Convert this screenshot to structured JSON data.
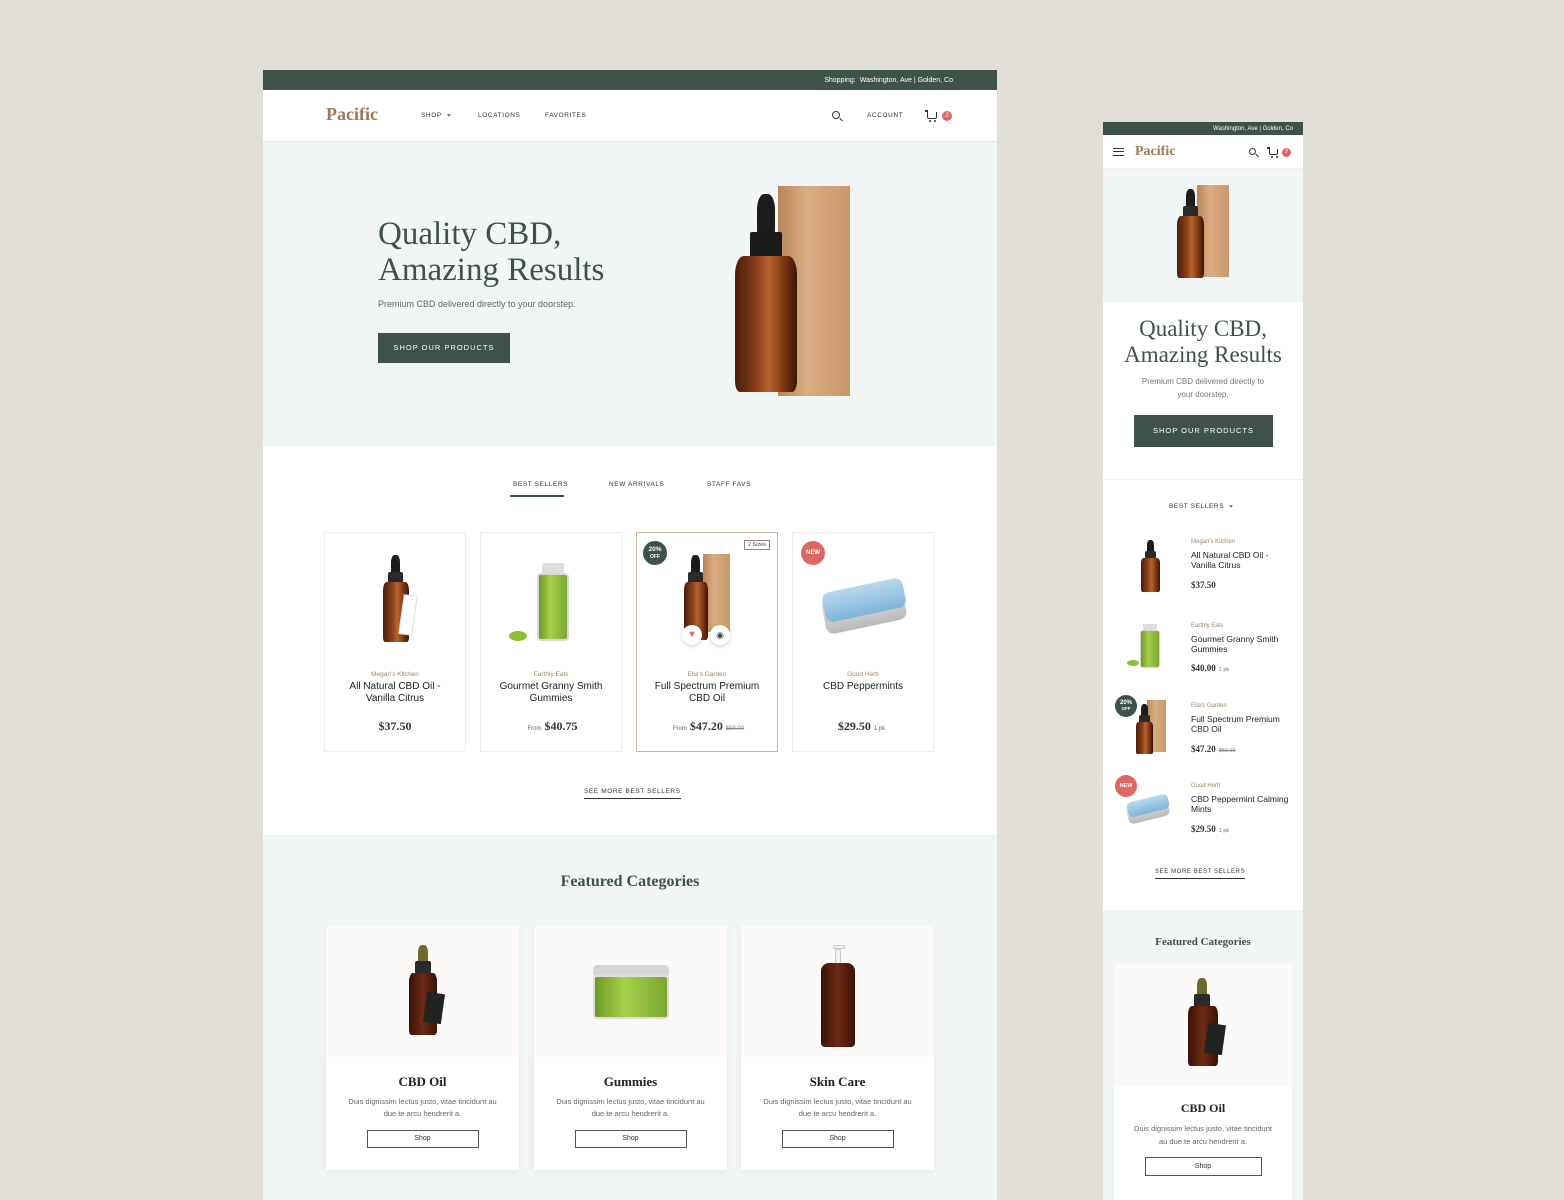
{
  "colors": {
    "brand_green": "#3f5249",
    "brand_gold": "#9a7b55",
    "badge_red": "#e06664",
    "hero_bg": "#f2f5f5",
    "page_bg": "#e2dfd8"
  },
  "desktop": {
    "topbar": {
      "label": "Shopping:",
      "location": "Washington, Ave | Golden, Co"
    },
    "nav": {
      "logo": "Pacific",
      "links": [
        "SHOP",
        "LOCATIONS",
        "FAVORITES"
      ],
      "account": "ACCOUNT",
      "cart_count": "2",
      "icons": [
        "search-icon",
        "cart-icon",
        "chevron-down-icon"
      ]
    },
    "hero": {
      "title_line1": "Quality CBD,",
      "title_line2": "Amazing Results",
      "subtitle": "Premium CBD delivered directly to your doorstep.",
      "cta": "SHOP OUR PRODUCTS"
    },
    "tabs": [
      "BEST SELLERS",
      "NEW ARRIVALS",
      "STAFF FAVS"
    ],
    "products": [
      {
        "brand": "Megan's Kitchen",
        "name": "All Natural CBD Oil - Vanilla Citrus",
        "price": "$37.50"
      },
      {
        "brand": "Earthly Eats",
        "name": "Gourmet Granny Smith Gummies",
        "from": "From",
        "price": "$40.75"
      },
      {
        "brand": "Ella's Garden",
        "name": "Full Spectrum Premium CBD Oil",
        "from": "From",
        "price": "$47.20",
        "old_price": "$59.00",
        "tag_line1": "20%",
        "tag_line2": "OFF",
        "sizes": "2 Sizes"
      },
      {
        "brand": "Good Herb",
        "name": "CBD Peppermints",
        "price": "$29.50",
        "unit": "1 pk",
        "tag": "NEW"
      }
    ],
    "see_more": "SEE MORE BEST SELLERS",
    "featured": {
      "title": "Featured Categories",
      "categories": [
        {
          "name": "CBD Oil",
          "desc": "Duis dignissim lectus justo, vitae tincidunt au due te arcu hendrerit a.",
          "cta": "Shop"
        },
        {
          "name": "Gummies",
          "desc": "Duis dignissim lectus justo, vitae tincidunt au due te arcu hendrerit a.",
          "cta": "Shop"
        },
        {
          "name": "Skin Care",
          "desc": "Duis dignissim lectus justo, vitae tincidunt au due te arcu hendrerit a.",
          "cta": "Shop"
        }
      ]
    }
  },
  "mobile": {
    "topbar": {
      "location": "Washington, Ave | Golden, Co"
    },
    "nav": {
      "logo": "Pacific",
      "cart_count": "2"
    },
    "hero": {
      "title_line1": "Quality CBD,",
      "title_line2": "Amazing Results",
      "subtitle": "Premium CBD delivered directly to your doorstep.",
      "cta": "SHOP OUR PRODUCTS"
    },
    "filter": "BEST SELLERS",
    "products": [
      {
        "brand": "Megan's Kitchen",
        "name": "All Natural CBD Oil - Vanilla Citrus",
        "price": "$37.50"
      },
      {
        "brand": "Earthly Eats",
        "name": "Gourmet Granny Smith Gummies",
        "price": "$40.00",
        "unit": "1 pk"
      },
      {
        "brand": "Ella's Garden",
        "name": "Full Spectrum Premium CBD Oil",
        "price": "$47.20",
        "old_price": "$59.00",
        "tag_line1": "20%",
        "tag_line2": "OFF"
      },
      {
        "brand": "Good Herb",
        "name": "CBD Peppermint Calming Mints",
        "price": "$29.50",
        "unit": "1 pk",
        "tag": "NEW"
      }
    ],
    "see_more": "SEE MORE BEST SELLERS",
    "featured": {
      "title": "Featured Categories",
      "category": {
        "name": "CBD Oil",
        "desc": "Duis dignissim lectus justo, vitae tincidunt au due te arcu hendrerit a.",
        "cta": "Shop"
      }
    }
  }
}
